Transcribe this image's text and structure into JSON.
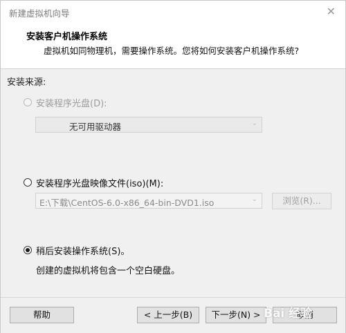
{
  "window": {
    "title": "新建虚拟机向导",
    "close_glyph": "✕"
  },
  "header": {
    "title": "安装客户机操作系统",
    "subtitle": "虚拟机如同物理机，需要操作系统。您将如何安装客户机操作系统?"
  },
  "install_source": {
    "label": "安装来源:",
    "options": [
      {
        "label": "安装程序光盘(D):",
        "selected": false,
        "enabled": false
      },
      {
        "label": "安装程序光盘映像文件(iso)(M):",
        "selected": false,
        "enabled": true
      },
      {
        "label": "稍后安装操作系统(S)。",
        "selected": true,
        "enabled": true
      }
    ],
    "disc_drive_value": "无可用驱动器",
    "iso_path_value": "E:\\下载\\CentOS-6.0-x86_64-bin-DVD1.iso",
    "browse_label": "浏览(R)...",
    "later_description": "创建的虚拟机将包含一个空白硬盘。"
  },
  "footer": {
    "help_label": "帮助",
    "back_label": "< 上一步(B)",
    "next_label": "下一步(N) >",
    "cancel_label": "取消"
  },
  "watermark": "Bai 经验",
  "icons": [
    "close-icon",
    "dropdown-arrow-icon"
  ]
}
